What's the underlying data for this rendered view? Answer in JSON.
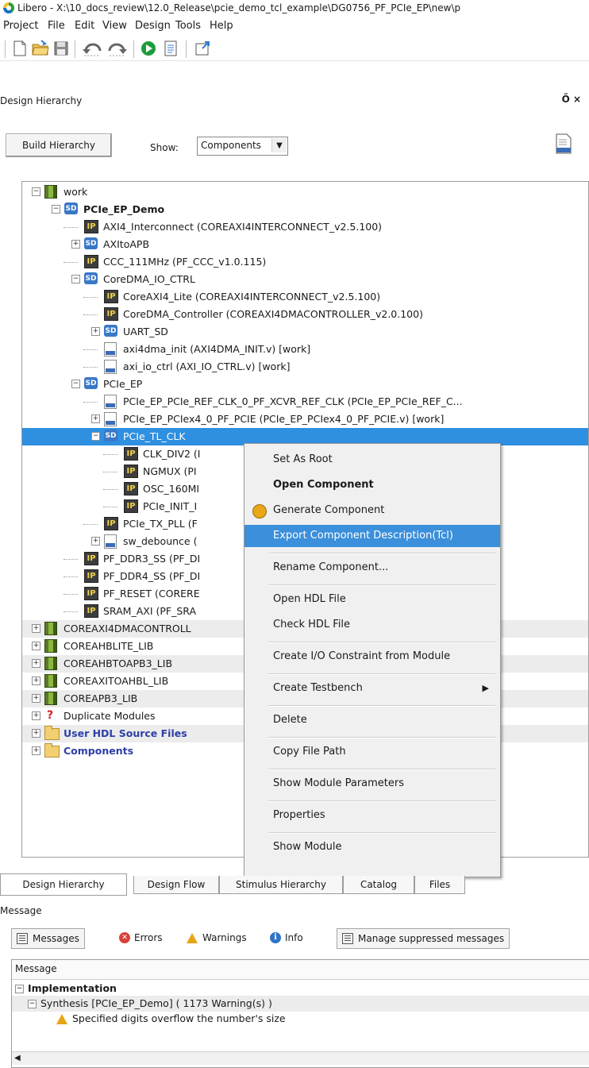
{
  "window": {
    "title": "Libero - X:\\10_docs_review\\12.0_Release\\pcie_demo_tcl_example\\DG0756_PF_PCIe_EP\\new\\p"
  },
  "menubar": [
    "Project",
    "File",
    "Edit",
    "View",
    "Design",
    "Tools",
    "Help"
  ],
  "toolbar": {
    "icons": [
      "new-file-icon",
      "open-folder-icon",
      "save-icon",
      "undo-icon",
      "redo-icon",
      "run-icon",
      "report-icon",
      "maximize-icon"
    ]
  },
  "panel": {
    "title": "Design Hierarchy",
    "controls": "Ő ×"
  },
  "hierarchy": {
    "build_button": "Build Hierarchy",
    "show_label": "Show:",
    "show_value": "Components"
  },
  "tree": [
    {
      "label": "work",
      "icon": "library",
      "depth": 0,
      "exp": "-"
    },
    {
      "label": "PCIe_EP_Demo",
      "icon": "sd",
      "depth": 1,
      "exp": "-",
      "bold": true
    },
    {
      "label": "AXI4_Interconnect (COREAXI4INTERCONNECT_v2.5.100)",
      "icon": "ip",
      "depth": 2
    },
    {
      "label": "AXItoAPB",
      "icon": "sd",
      "depth": 2,
      "exp": "+"
    },
    {
      "label": "CCC_111MHz (PF_CCC_v1.0.115)",
      "icon": "ip",
      "depth": 2
    },
    {
      "label": "CoreDMA_IO_CTRL",
      "icon": "sd",
      "depth": 2,
      "exp": "-"
    },
    {
      "label": "CoreAXI4_Lite (COREAXI4INTERCONNECT_v2.5.100)",
      "icon": "ip",
      "depth": 3
    },
    {
      "label": "CoreDMA_Controller (COREAXI4DMACONTROLLER_v2.0.100)",
      "icon": "ip",
      "depth": 3
    },
    {
      "label": "UART_SD",
      "icon": "sd",
      "depth": 3,
      "exp": "+"
    },
    {
      "label": "axi4dma_init (AXI4DMA_INIT.v) [work]",
      "icon": "hdl",
      "depth": 3
    },
    {
      "label": "axi_io_ctrl (AXI_IO_CTRL.v) [work]",
      "icon": "hdl",
      "depth": 3
    },
    {
      "label": "PCIe_EP",
      "icon": "sd",
      "depth": 2,
      "exp": "-"
    },
    {
      "label": "PCIe_EP_PCIe_REF_CLK_0_PF_XCVR_REF_CLK (PCIe_EP_PCIe_REF_C...",
      "icon": "hdl",
      "depth": 3
    },
    {
      "label": "PCIe_EP_PCIex4_0_PF_PCIE (PCIe_EP_PCIex4_0_PF_PCIE.v) [work]",
      "icon": "hdl",
      "depth": 3,
      "exp": "+"
    },
    {
      "label": "PCIe_TL_CLK",
      "icon": "sd",
      "depth": 3,
      "exp": "-",
      "selected": true
    },
    {
      "label": "CLK_DIV2 (I",
      "icon": "ip",
      "depth": 4
    },
    {
      "label": "NGMUX (PI",
      "icon": "ip",
      "depth": 4
    },
    {
      "label": "OSC_160MI",
      "icon": "ip",
      "depth": 4
    },
    {
      "label": "PCIe_INIT_I",
      "icon": "ip",
      "depth": 4
    },
    {
      "label": "PCIe_TX_PLL (F",
      "icon": "ip",
      "depth": 3
    },
    {
      "label": "sw_debounce (",
      "icon": "hdl",
      "depth": 3,
      "exp": "+"
    },
    {
      "label": "PF_DDR3_SS (PF_DI",
      "icon": "ip",
      "depth": 2
    },
    {
      "label": "PF_DDR4_SS (PF_DI",
      "icon": "ip",
      "depth": 2
    },
    {
      "label": "PF_RESET (CORERE",
      "icon": "ip",
      "depth": 2
    },
    {
      "label": "SRAM_AXI (PF_SRA",
      "icon": "ip",
      "depth": 2
    },
    {
      "label": "COREAXI4DMACONTROLL",
      "icon": "library",
      "depth": 0,
      "exp": "+",
      "shade": true
    },
    {
      "label": "COREAHBLITE_LIB",
      "icon": "library",
      "depth": 0,
      "exp": "+"
    },
    {
      "label": "COREAHBTOAPB3_LIB",
      "icon": "library",
      "depth": 0,
      "exp": "+",
      "shade": true
    },
    {
      "label": "COREAXITOAHBL_LIB",
      "icon": "library",
      "depth": 0,
      "exp": "+"
    },
    {
      "label": "COREAPB3_LIB",
      "icon": "library",
      "depth": 0,
      "exp": "+",
      "shade": true
    },
    {
      "label": "Duplicate Modules",
      "icon": "question",
      "depth": 0,
      "exp": "+"
    },
    {
      "label": "User HDL Source Files",
      "icon": "folder",
      "depth": 0,
      "exp": "+",
      "blue": true,
      "shade": true
    },
    {
      "label": "Components",
      "icon": "folder",
      "depth": 0,
      "exp": "+",
      "blue": true
    }
  ],
  "context_menu": [
    {
      "label": "Set As Root"
    },
    {
      "label": "Open Component",
      "bold": true
    },
    {
      "label": "Generate Component",
      "icon": "generate-icon"
    },
    {
      "label": "Export Component Description(Tcl)",
      "highlighted": true
    },
    {
      "separator": true
    },
    {
      "label": "Rename Component..."
    },
    {
      "separator": true
    },
    {
      "label": "Open HDL File"
    },
    {
      "label": "Check HDL File"
    },
    {
      "separator": true
    },
    {
      "label": "Create I/O Constraint from Module"
    },
    {
      "separator": true
    },
    {
      "label": "Create Testbench",
      "submenu": true
    },
    {
      "separator": true
    },
    {
      "label": "Delete"
    },
    {
      "separator": true
    },
    {
      "label": "Copy File Path"
    },
    {
      "separator": true
    },
    {
      "label": "Show Module Parameters"
    },
    {
      "separator": true
    },
    {
      "label": "Properties"
    },
    {
      "separator": true
    },
    {
      "label": "Show Module"
    }
  ],
  "bottom_tabs": [
    "Design Hierarchy",
    "Design Flow",
    "Stimulus Hierarchy",
    "Catalog",
    "Files"
  ],
  "message_panel": {
    "title": "Message",
    "buttons": [
      "Messages",
      "Errors",
      "Warnings",
      "Info",
      "Manage suppressed messages"
    ],
    "column_header": "Message",
    "rows": [
      {
        "text": "Implementation",
        "bold": true
      },
      {
        "text": "Synthesis [PCIe_EP_Demo] ( 1173 Warning(s) )"
      },
      {
        "text": "Specified digits overflow the number's size"
      }
    ]
  }
}
